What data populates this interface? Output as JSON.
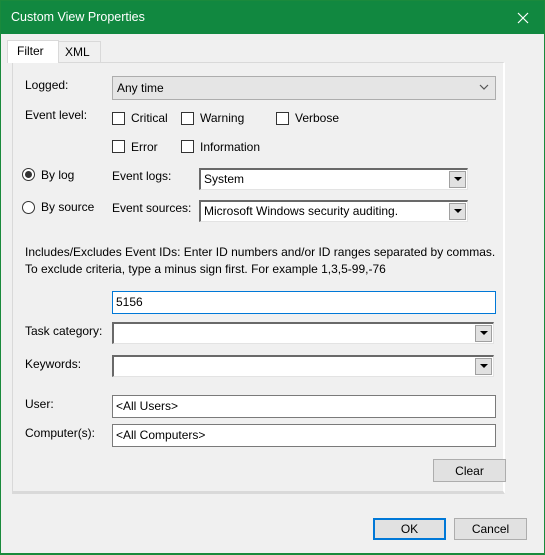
{
  "window": {
    "title": "Custom View Properties",
    "close_icon": "close-icon",
    "accent_color": "#118840"
  },
  "tabs": [
    {
      "label": "Filter",
      "active": true
    },
    {
      "label": "XML",
      "active": false
    }
  ],
  "filter": {
    "logged": {
      "label": "Logged:",
      "value": "Any time"
    },
    "event_level": {
      "label": "Event level:",
      "options": [
        {
          "label": "Critical",
          "checked": false
        },
        {
          "label": "Warning",
          "checked": false
        },
        {
          "label": "Verbose",
          "checked": false
        },
        {
          "label": "Error",
          "checked": false
        },
        {
          "label": "Information",
          "checked": false
        }
      ]
    },
    "by_log": {
      "label": "By log",
      "selected": true
    },
    "by_source": {
      "label": "By source",
      "selected": false
    },
    "event_logs": {
      "label": "Event logs:",
      "value": "System"
    },
    "event_sources": {
      "label": "Event sources:",
      "value": "Microsoft Windows security auditing."
    },
    "event_ids_description": "Includes/Excludes Event IDs: Enter ID numbers and/or ID ranges separated by commas. To exclude criteria, type a minus sign first. For example 1,3,5-99,-76",
    "event_ids_value": "5156",
    "task_category": {
      "label": "Task category:",
      "value": ""
    },
    "keywords": {
      "label": "Keywords:",
      "value": ""
    },
    "user": {
      "label": "User:",
      "value": "<All Users>"
    },
    "computers": {
      "label": "Computer(s):",
      "value": "<All Computers>"
    },
    "clear_label": "Clear"
  },
  "footer": {
    "ok_label": "OK",
    "cancel_label": "Cancel"
  }
}
